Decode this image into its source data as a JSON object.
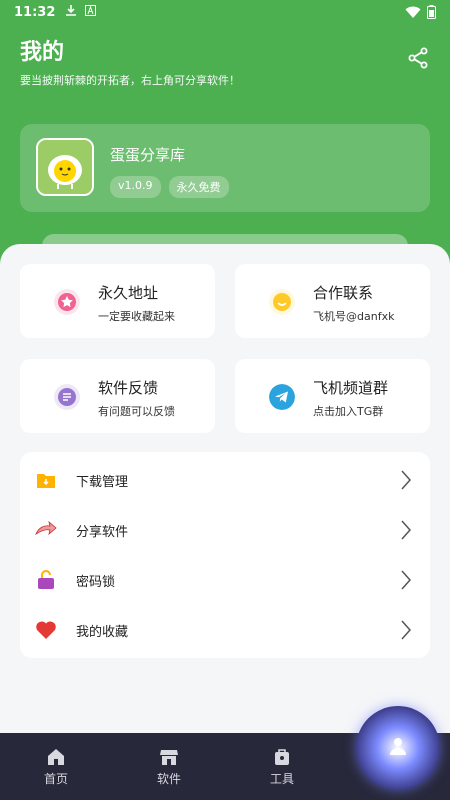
{
  "status_bar": {
    "time": "11:32",
    "download_icon": "download-icon",
    "a_icon": "a-icon",
    "wifi_icon": "wifi-icon",
    "battery_icon": "battery-icon"
  },
  "header": {
    "title": "我的",
    "subtitle": "要当披荆斩棘的开拓者，右上角可分享软件！",
    "share_icon": "share-icon"
  },
  "app_card": {
    "name": "蛋蛋分享库",
    "version": "v1.0.9",
    "license": "永久免费"
  },
  "features": [
    {
      "title": "永久地址",
      "subtitle": "一定要收藏起来",
      "icon": "star-icon",
      "color": "#f06292"
    },
    {
      "title": "合作联系",
      "subtitle": "飞机号@danfxk",
      "icon": "smile-icon",
      "color": "#ffca28"
    },
    {
      "title": "软件反馈",
      "subtitle": "有问题可以反馈",
      "icon": "feedback-icon",
      "color": "#9575cd"
    },
    {
      "title": "飞机频道群",
      "subtitle": "点击加入TG群",
      "icon": "telegram-icon",
      "color": "#2aa3df"
    }
  ],
  "menu": [
    {
      "label": "下载管理",
      "icon": "download-folder-icon",
      "color": "#ffb300"
    },
    {
      "label": "分享软件",
      "icon": "share-hand-icon",
      "color": "#ef5350"
    },
    {
      "label": "密码锁",
      "icon": "lock-icon",
      "color": "#ab47bc"
    },
    {
      "label": "我的收藏",
      "icon": "heart-icon",
      "color": "#e53935"
    }
  ],
  "bottom_nav": [
    {
      "label": "首页",
      "icon": "home-icon"
    },
    {
      "label": "软件",
      "icon": "store-icon"
    },
    {
      "label": "工具",
      "icon": "toolbox-icon"
    }
  ],
  "colors": {
    "primary": "#4caf50",
    "nav_bg": "#27283a",
    "sheet_bg": "#f5f6f8"
  }
}
